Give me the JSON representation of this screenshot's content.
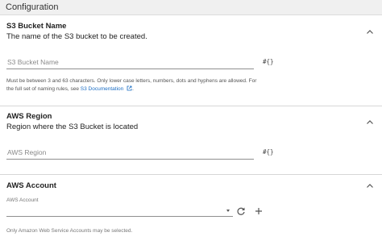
{
  "header": {
    "title": "Configuration"
  },
  "bucket_name": {
    "title": "S3 Bucket Name",
    "description": "The name of the S3 bucket to be created.",
    "placeholder": "S3 Bucket Name",
    "expression_toggle": "#{}",
    "help_line1": "Must be between 3 and 63 characters. Only lower case letters, numbers, dots and hyphens are allowed. For",
    "help_line2_prefix": "the full set of naming rules, see",
    "help_link": "S3 Documentation"
  },
  "region": {
    "title": "AWS Region",
    "description": "Region where the S3 Bucket is located",
    "placeholder": "AWS Region",
    "expression_toggle": "#{}"
  },
  "account": {
    "title": "AWS Account",
    "field_label": "AWS Account",
    "help": "Only Amazon Web Service Accounts may be selected."
  },
  "icons": {
    "collapse": "chevron-up-icon",
    "external_link": "external-link-icon",
    "refresh": "refresh-icon",
    "add": "plus-icon",
    "dropdown": "caret-down-icon"
  },
  "colors": {
    "link": "#1a6dc4",
    "header_bg": "#f0f0f0"
  }
}
